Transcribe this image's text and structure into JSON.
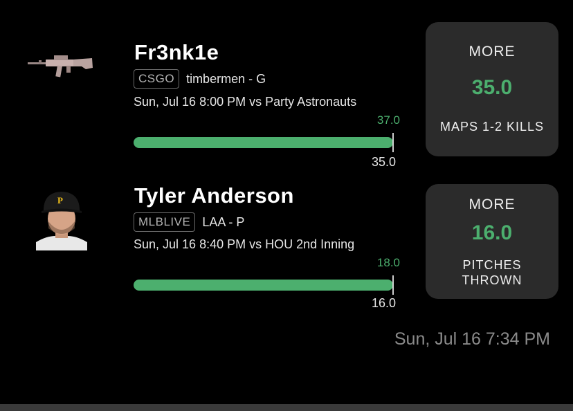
{
  "picks": [
    {
      "player": "Fr3nk1e",
      "league": "CSGO",
      "team_pos": "timbermen - G",
      "game": "Sun, Jul 16 8:00 PM  vs Party Astronauts",
      "projection_top": "37.0",
      "line_under": "35.0",
      "progress_fraction": 1.0,
      "direction": "MORE",
      "line": "35.0",
      "stat": "MAPS 1-2 KILLS",
      "avatar_icon": "rifle-icon"
    },
    {
      "player": "Tyler Anderson",
      "league": "MLBLIVE",
      "team_pos": "LAA - P",
      "game": "Sun, Jul 16 8:40 PM  vs HOU 2nd Inning",
      "projection_top": "18.0",
      "line_under": "16.0",
      "progress_fraction": 1.0,
      "direction": "MORE",
      "line": "16.0",
      "stat_line1": "PITCHES",
      "stat_line2": "THROWN",
      "avatar_icon": "player-headshot"
    }
  ],
  "timestamp": "Sun, Jul 16 7:34 PM",
  "colors": {
    "accent": "#4caf6e",
    "card_bg": "#2b2b2b",
    "background": "#000000"
  }
}
